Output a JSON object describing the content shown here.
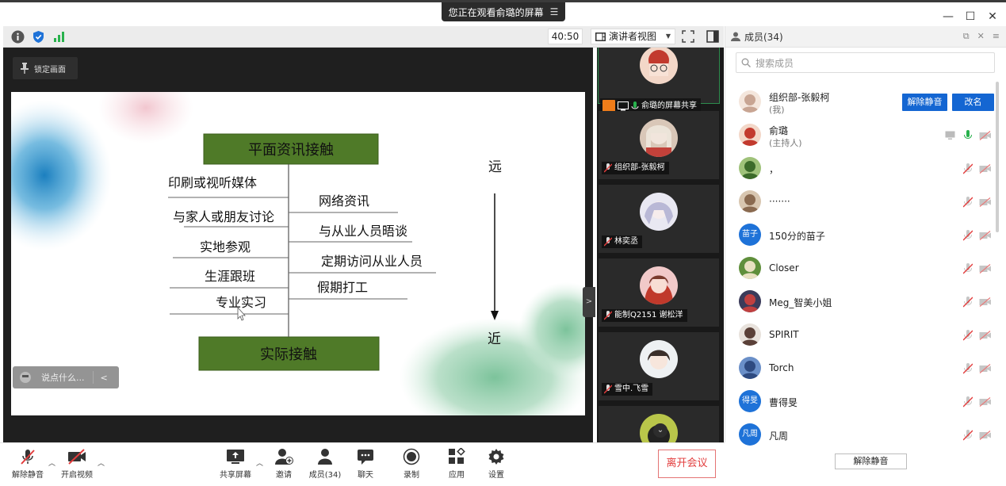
{
  "window": {
    "share_banner": "您正在观看俞璐的屏幕",
    "controls": {
      "minimize": "—",
      "maximize": "☐",
      "close": "✕"
    }
  },
  "toolbar": {
    "timer": "40:50",
    "view_mode": "演讲者视图"
  },
  "stage": {
    "lock_label": "锁定画面",
    "chat_placeholder": "说点什么...",
    "slide": {
      "top_box": "平面资讯接触",
      "bottom_box": "实际接触",
      "far_label": "远",
      "near_label": "近",
      "left_items": [
        "印刷或视听媒体",
        "与家人或朋友讨论",
        "实地参观",
        "生涯跟班",
        "专业实习"
      ],
      "right_items": [
        "网络资讯",
        "与从业人员晤谈",
        "定期访问从业人员",
        "假期打工"
      ]
    }
  },
  "tiles": [
    {
      "name": "俞璐的屏幕共享",
      "active": true
    },
    {
      "name": "组织部-张毅柯",
      "active": false
    },
    {
      "name": "林奕丞",
      "active": false
    },
    {
      "name": "能制Q2151 谢松洋",
      "active": false
    },
    {
      "name": "雪中.飞雪",
      "active": false
    },
    {
      "name": "",
      "active": false
    }
  ],
  "members_panel": {
    "title": "成员(34)",
    "search_placeholder": "搜索成员",
    "unmute_label": "解除静音",
    "rename_label": "改名",
    "unmute_all_label": "解除静音",
    "members": [
      {
        "name": "组织部-张毅柯",
        "sub": "(我)",
        "avatar": "photo-1"
      },
      {
        "name": "俞璐",
        "sub": "(主持人)",
        "avatar": "photo-2"
      },
      {
        "name": "，",
        "sub": "",
        "avatar": "photo-3"
      },
      {
        "name": "·······",
        "sub": "",
        "avatar": "photo-4"
      },
      {
        "name": "150分的苗子",
        "sub": "",
        "avatar_text": "苗子"
      },
      {
        "name": "Closer",
        "sub": "",
        "avatar": "photo-5"
      },
      {
        "name": "Meg_智美小姐",
        "sub": "",
        "avatar": "photo-6"
      },
      {
        "name": "SPIRIT",
        "sub": "",
        "avatar": "photo-7"
      },
      {
        "name": "Torch",
        "sub": "",
        "avatar": "photo-8"
      },
      {
        "name": "曹得旻",
        "sub": "",
        "avatar_text": "得旻"
      },
      {
        "name": "凡周",
        "sub": "",
        "avatar_text": "凡周"
      }
    ]
  },
  "controlbar": {
    "unmute": "解除静音",
    "start_video": "开启视频",
    "share_screen": "共享屏幕",
    "invite": "邀请",
    "members": "成员(34)",
    "chat": "聊天",
    "record": "录制",
    "apps": "应用",
    "settings": "设置",
    "leave": "离开会议"
  },
  "colors": {
    "accent_blue": "#1466d2",
    "slide_box_green": "#4f7a28",
    "leave_red": "#e23c3c",
    "mic_green": "#28b14c"
  }
}
